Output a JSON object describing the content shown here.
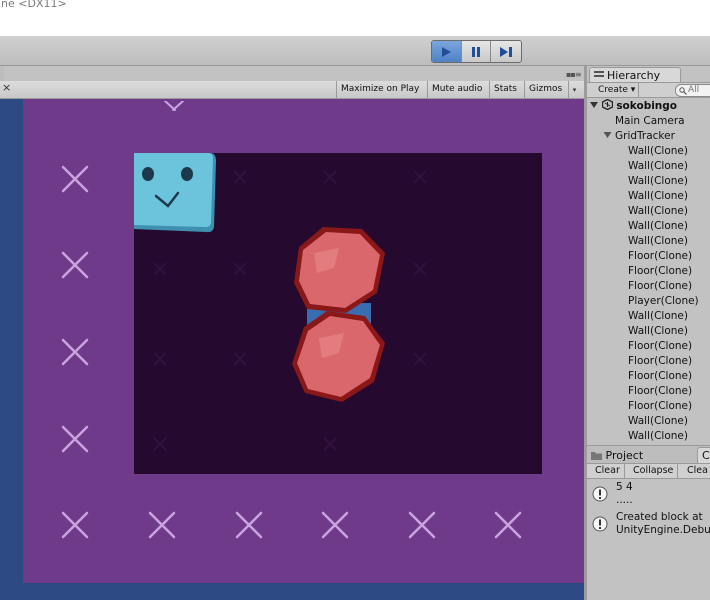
{
  "window": {
    "title": "ine <DX11>"
  },
  "toolbar": {
    "play_icon": "play-icon",
    "pause_icon": "pause-icon",
    "step_icon": "step-icon",
    "play_active": true,
    "menu_dots": "▪▪≡"
  },
  "game_view": {
    "close_glyph": "×",
    "buttons": {
      "maximize": "Maximize on Play",
      "mute": "Mute audio",
      "stats": "Stats",
      "gizmos": "Gizmos"
    },
    "gizmos_dropdown": "▾",
    "colors": {
      "background": "#2d4a85",
      "arena": "#6f3a89",
      "board": "#25092f",
      "player": "#5cb2cc",
      "block": "#d9676b",
      "block_border": "#8a1818",
      "x_mark": "#c9a4e0"
    }
  },
  "hierarchy": {
    "tab_label": "Hierarchy",
    "create_label": "Create ▾",
    "search_value": "All",
    "scene_name": "sokobingo",
    "items": [
      {
        "label": "Main Camera",
        "indent": 1
      },
      {
        "label": "GridTracker",
        "indent": 1,
        "expanded": true
      },
      {
        "label": "Wall(Clone)",
        "indent": 2
      },
      {
        "label": "Wall(Clone)",
        "indent": 2
      },
      {
        "label": "Wall(Clone)",
        "indent": 2
      },
      {
        "label": "Wall(Clone)",
        "indent": 2
      },
      {
        "label": "Wall(Clone)",
        "indent": 2
      },
      {
        "label": "Wall(Clone)",
        "indent": 2
      },
      {
        "label": "Wall(Clone)",
        "indent": 2
      },
      {
        "label": "Floor(Clone)",
        "indent": 2
      },
      {
        "label": "Floor(Clone)",
        "indent": 2
      },
      {
        "label": "Floor(Clone)",
        "indent": 2
      },
      {
        "label": "Player(Clone)",
        "indent": 2
      },
      {
        "label": "Wall(Clone)",
        "indent": 2
      },
      {
        "label": "Wall(Clone)",
        "indent": 2
      },
      {
        "label": "Floor(Clone)",
        "indent": 2
      },
      {
        "label": "Floor(Clone)",
        "indent": 2
      },
      {
        "label": "Floor(Clone)",
        "indent": 2
      },
      {
        "label": "Floor(Clone)",
        "indent": 2
      },
      {
        "label": "Floor(Clone)",
        "indent": 2
      },
      {
        "label": "Wall(Clone)",
        "indent": 2
      },
      {
        "label": "Wall(Clone)",
        "indent": 2
      },
      {
        "label": "Floor(Clone)",
        "indent": 2
      }
    ]
  },
  "bottom_panel": {
    "project_tab": "Project",
    "console_tab": "C",
    "console_buttons": {
      "clear": "Clear",
      "collapse": "Collapse",
      "clear_on_play": "Clea"
    },
    "log": [
      {
        "line1": "5 4",
        "line2": "....."
      },
      {
        "line1": "Created block at",
        "line2": "UnityEngine.Debu"
      }
    ]
  }
}
